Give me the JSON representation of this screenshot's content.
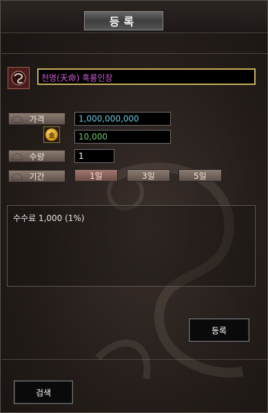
{
  "window": {
    "title": "등록"
  },
  "item": {
    "name": "천명(天命) 혹룡인장",
    "icon": "dragon-seal-icon"
  },
  "price": {
    "label": "가격",
    "value": "1,000,000,000"
  },
  "coin": {
    "value": "10,000",
    "icon": "gold-coin-icon"
  },
  "quantity": {
    "label": "수량",
    "value": "1"
  },
  "duration": {
    "label": "기간",
    "options": [
      "1일",
      "3일",
      "5일"
    ],
    "selected": "1일"
  },
  "fee": {
    "text": "수수료 1,000 (1%)"
  },
  "buttons": {
    "register": "등록",
    "search": "검색"
  },
  "colors": {
    "item_name": "#d05ad8",
    "price": "#6ecbe0",
    "coin_value": "#6ec86e",
    "border_gold": "#c9b15e"
  }
}
